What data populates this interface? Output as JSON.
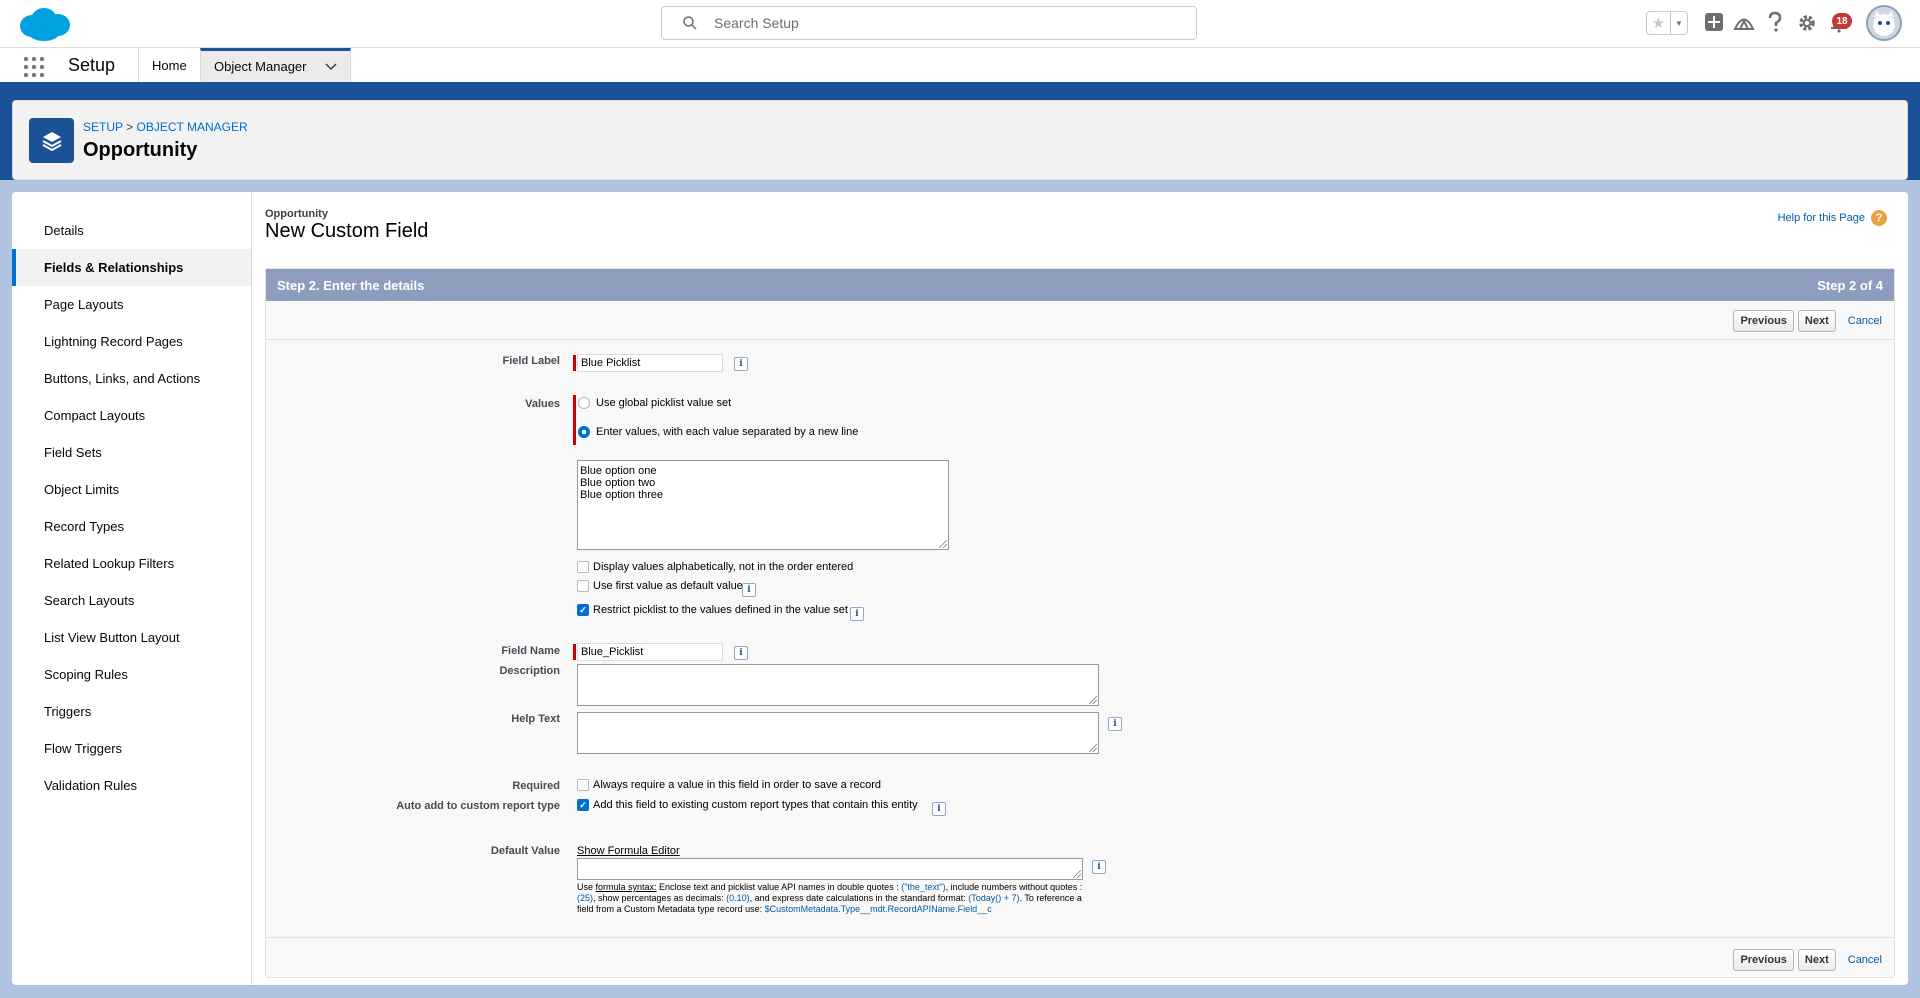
{
  "colors": {
    "brand": "#1b5297",
    "link": "#015ba7",
    "required": "#cc0000",
    "step_bar": "#8e9dbe",
    "accent": "#0070d2"
  },
  "header": {
    "search_placeholder": "Search Setup",
    "notification_count": "18",
    "icons": [
      "salesforce-cloud-logo",
      "search-icon",
      "star-icon",
      "chevron-down-icon",
      "add-icon",
      "trailhead-icon",
      "help-icon",
      "gear-icon",
      "bell-icon",
      "user-avatar"
    ]
  },
  "app_nav": {
    "app_name": "Setup",
    "tabs": [
      {
        "label": "Home",
        "active": false
      },
      {
        "label": "Object Manager",
        "active": true
      }
    ]
  },
  "page_header": {
    "breadcrumb": [
      "SETUP",
      "OBJECT MANAGER"
    ],
    "separator": ">",
    "title": "Opportunity"
  },
  "sidebar": {
    "items": [
      {
        "label": "Details",
        "active": false
      },
      {
        "label": "Fields & Relationships",
        "active": true
      },
      {
        "label": "Page Layouts",
        "active": false
      },
      {
        "label": "Lightning Record Pages",
        "active": false
      },
      {
        "label": "Buttons, Links, and Actions",
        "active": false
      },
      {
        "label": "Compact Layouts",
        "active": false
      },
      {
        "label": "Field Sets",
        "active": false
      },
      {
        "label": "Object Limits",
        "active": false
      },
      {
        "label": "Record Types",
        "active": false
      },
      {
        "label": "Related Lookup Filters",
        "active": false
      },
      {
        "label": "Search Layouts",
        "active": false
      },
      {
        "label": "List View Button Layout",
        "active": false
      },
      {
        "label": "Scoping Rules",
        "active": false
      },
      {
        "label": "Triggers",
        "active": false
      },
      {
        "label": "Flow Triggers",
        "active": false
      },
      {
        "label": "Validation Rules",
        "active": false
      }
    ]
  },
  "content": {
    "object_name": "Opportunity",
    "title": "New Custom Field",
    "help_link": "Help for this Page",
    "step_title": "Step 2. Enter the details",
    "step_count": "Step 2 of 4",
    "buttons": {
      "previous": "Previous",
      "next": "Next",
      "cancel": "Cancel"
    }
  },
  "form": {
    "field_label": {
      "label": "Field Label",
      "value": "Blue Picklist"
    },
    "values": {
      "label": "Values",
      "option_global": "Use global picklist value set",
      "option_enter": "Enter values, with each value separated by a new line",
      "selected": "option_enter",
      "entries": [
        "Blue option one",
        "Blue option two",
        "Blue option three"
      ]
    },
    "display_alpha": {
      "label": "Display values alphabetically, not in the order entered",
      "checked": false
    },
    "first_default": {
      "label": "Use first value as default value",
      "checked": false
    },
    "restrict": {
      "label": "Restrict picklist to the values defined in the value set",
      "checked": true
    },
    "field_name": {
      "label": "Field Name",
      "value": "Blue_Picklist"
    },
    "description": {
      "label": "Description",
      "value": ""
    },
    "help_text": {
      "label": "Help Text",
      "value": ""
    },
    "required": {
      "label": "Required",
      "option": "Always require a value in this field in order to save a record",
      "checked": false
    },
    "auto_add": {
      "label": "Auto add to custom report type",
      "option": "Add this field to existing custom report types that contain this entity",
      "checked": true
    },
    "default_value": {
      "label": "Default Value",
      "formula_editor_link": "Show Formula Editor",
      "value": "",
      "hint": {
        "use": "Use ",
        "syntax_link": "formula syntax:",
        "t1": " Enclose text and picklist value API names in double quotes : ",
        "ex1": "(\"the_text\")",
        "t2": ", include numbers without quotes : ",
        "ex2": "(25)",
        "t3": ", show percentages as decimals: ",
        "ex3": "(0.10)",
        "t4": ", and express date calculations in the standard format: ",
        "ex4": "(Today() + 7)",
        "t5": ". To reference a field from a Custom Metadata type record use: ",
        "ex5": "$CustomMetadata.Type__mdt.RecordAPIName.Field__c"
      }
    }
  }
}
